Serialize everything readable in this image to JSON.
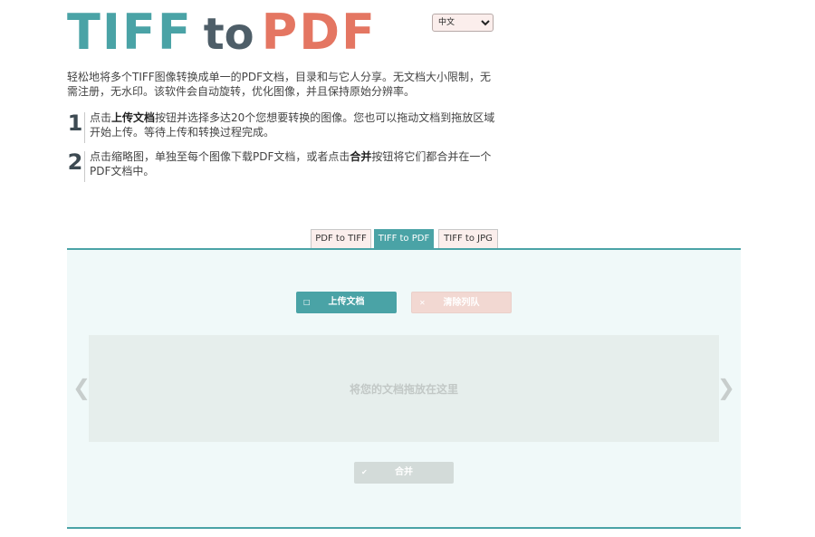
{
  "logo": {
    "word1": "TIFF",
    "word2": "to",
    "word3": "PDF"
  },
  "language": {
    "selected": "中文"
  },
  "intro": "轻松地将多个TIFF图像转换成单一的PDF文档，目录和与它人分享。无文档大小限制，无需注册，无水印。该软件会自动旋转，优化图像，并且保持原始分辨率。",
  "steps": [
    {
      "number": "1",
      "pre": "点击",
      "bold": "上传文档",
      "post": "按钮并选择多达20个您想要转换的图像。您也可以拖动文档到拖放区域开始上传。等待上传和转换过程完成。"
    },
    {
      "number": "2",
      "pre": "点击缩略图，单独至每个图像下载PDF文档，或者点击",
      "bold": "合并",
      "post": "按钮将它们都合并在一个PDF文档中。"
    }
  ],
  "tabs": [
    "PDF to TIFF",
    "TIFF to PDF",
    "TIFF to JPG"
  ],
  "active_tab": "TIFF to PDF",
  "buttons": {
    "upload": "上传文档",
    "clear": "清除列队",
    "merge": "合并"
  },
  "icons": {
    "upload": "folder-open-icon",
    "clear": "x-icon",
    "merge": "check-icon",
    "prev": "chevron-left-icon",
    "next": "chevron-right-icon"
  },
  "dropzone_text": "将您的文档拖放在这里",
  "arrows": {
    "prev": "❮",
    "next": "❯"
  },
  "colors": {
    "teal": "#4aa3a6",
    "coral": "#e47662",
    "slate": "#4e5e68"
  }
}
